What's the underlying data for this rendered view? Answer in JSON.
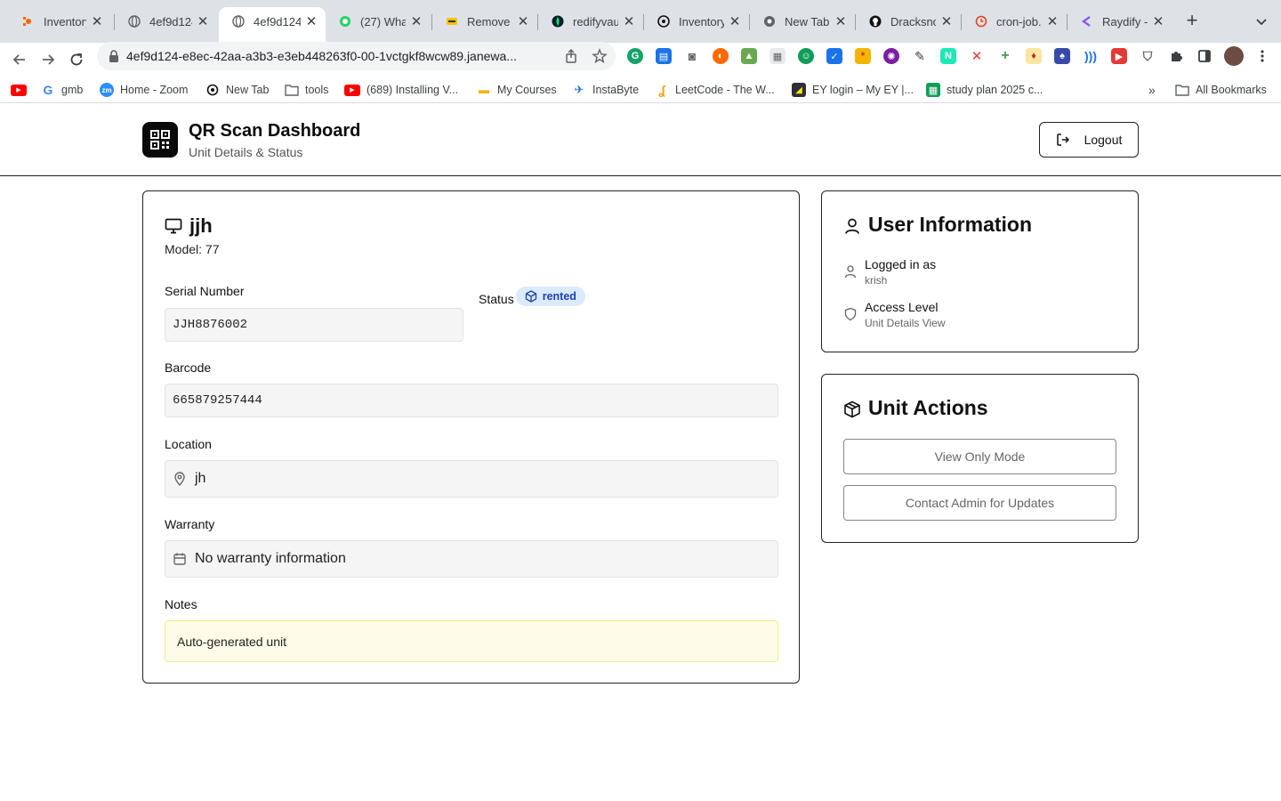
{
  "browser": {
    "tabs": [
      {
        "title": "Inventory",
        "icon": "grafana-icon"
      },
      {
        "title": "4ef9d124",
        "icon": "globe-icon"
      },
      {
        "title": "4ef9d124",
        "icon": "globe-icon",
        "active": true
      },
      {
        "title": "(27) What",
        "icon": "whatsapp-icon"
      },
      {
        "title": "Remove E",
        "icon": "remove-bg-icon"
      },
      {
        "title": "redifyvaul",
        "icon": "mongodb-icon"
      },
      {
        "title": "Inventory",
        "icon": "openai-icon"
      },
      {
        "title": "New Tab",
        "icon": "chrome-icon"
      },
      {
        "title": "Dracksno",
        "icon": "github-icon"
      },
      {
        "title": "cron-job.o",
        "icon": "cron-icon"
      },
      {
        "title": "Raydify -",
        "icon": "raydify-icon"
      }
    ],
    "new_tab_label": "+",
    "url": "4ef9d124-e8ec-42aa-a3b3-e3eb448263f0-00-1vctgkf8wcw89.janewa...",
    "bookmarks": [
      {
        "label": "",
        "icon": "youtube-icon"
      },
      {
        "label": "gmb",
        "icon": "google-icon"
      },
      {
        "label": "Home - Zoom",
        "icon": "zoom-icon"
      },
      {
        "label": "New Tab",
        "icon": "openai-icon"
      },
      {
        "label": "tools",
        "icon": "folder-icon"
      },
      {
        "label": "(689) Installing V...",
        "icon": "youtube-icon"
      },
      {
        "label": "My Courses",
        "icon": "courses-icon"
      },
      {
        "label": "InstaByte",
        "icon": "instabyte-icon"
      },
      {
        "label": "LeetCode - The W...",
        "icon": "leetcode-icon"
      },
      {
        "label": "EY login – My EY |...",
        "icon": "ey-icon"
      },
      {
        "label": "study plan 2025 c...",
        "icon": "sheets-icon"
      }
    ],
    "bookmarks_overflow": "»",
    "all_bookmarks": "All Bookmarks"
  },
  "header": {
    "title": "QR Scan Dashboard",
    "subtitle": "Unit Details & Status",
    "logout_label": "Logout"
  },
  "unit": {
    "name": "jjh",
    "model": "Model: 77",
    "serial_label": "Serial Number",
    "serial_value": "JJH8876002",
    "status_label": "Status",
    "status_value": "rented",
    "barcode_label": "Barcode",
    "barcode_value": "665879257444",
    "location_label": "Location",
    "location_value": "jh",
    "warranty_label": "Warranty",
    "warranty_value": "No warranty information",
    "notes_label": "Notes",
    "notes_value": "Auto-generated unit"
  },
  "user_info": {
    "title": "User Information",
    "logged_in_label": "Logged in as",
    "logged_in_value": "krish",
    "access_label": "Access Level",
    "access_value": "Unit Details View"
  },
  "unit_actions": {
    "title": "Unit Actions",
    "view_only_label": "View Only Mode",
    "contact_admin_label": "Contact Admin for Updates"
  },
  "colors": {
    "badge_bg": "#dbeafe",
    "badge_text": "#1e40af",
    "notes_bg": "#fefce8",
    "notes_border": "#fde68a"
  }
}
